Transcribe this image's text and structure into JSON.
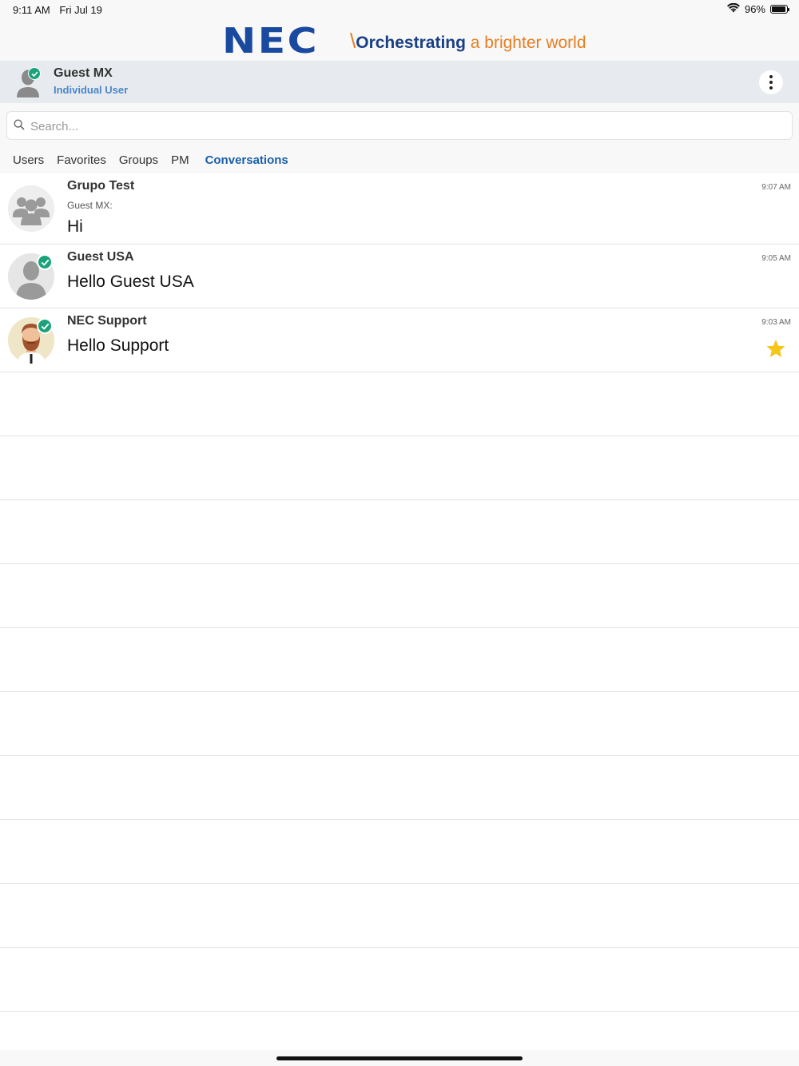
{
  "status_bar": {
    "time": "9:11 AM",
    "date": "Fri Jul 19",
    "battery_text": "96%",
    "battery_level": 0.96
  },
  "brand": {
    "logo": "NEC",
    "tagline_strong": "Orchestrating",
    "tagline_rest": " a brighter world",
    "colors": {
      "logo": "#1a4aa0",
      "accent": "#e67e22"
    }
  },
  "user": {
    "name": "Guest MX",
    "role": "Individual User",
    "presence": "online"
  },
  "search": {
    "placeholder": "Search..."
  },
  "tabs": [
    {
      "label": "Users",
      "active": false
    },
    {
      "label": "Favorites",
      "active": false
    },
    {
      "label": "Groups",
      "active": false
    },
    {
      "label": "PM",
      "active": false
    },
    {
      "label": "Conversations",
      "active": true
    }
  ],
  "conversations": [
    {
      "name": "Grupo Test",
      "sender": "Guest MX:",
      "message": "Hi",
      "time": "9:07 AM",
      "avatar": "group-icon",
      "online": false,
      "favorite": false
    },
    {
      "name": "Guest USA",
      "sender": "",
      "message": "Hello Guest USA",
      "time": "9:05 AM",
      "avatar": "person-silhouette-icon",
      "online": true,
      "favorite": false
    },
    {
      "name": "NEC Support",
      "sender": "",
      "message": "Hello Support",
      "time": "9:03 AM",
      "avatar": "bearded-man-avatar",
      "online": true,
      "favorite": true
    }
  ],
  "colors": {
    "online_badge": "#1aa37a",
    "active_tab": "#1a5fa8",
    "star": "#f5c518"
  }
}
